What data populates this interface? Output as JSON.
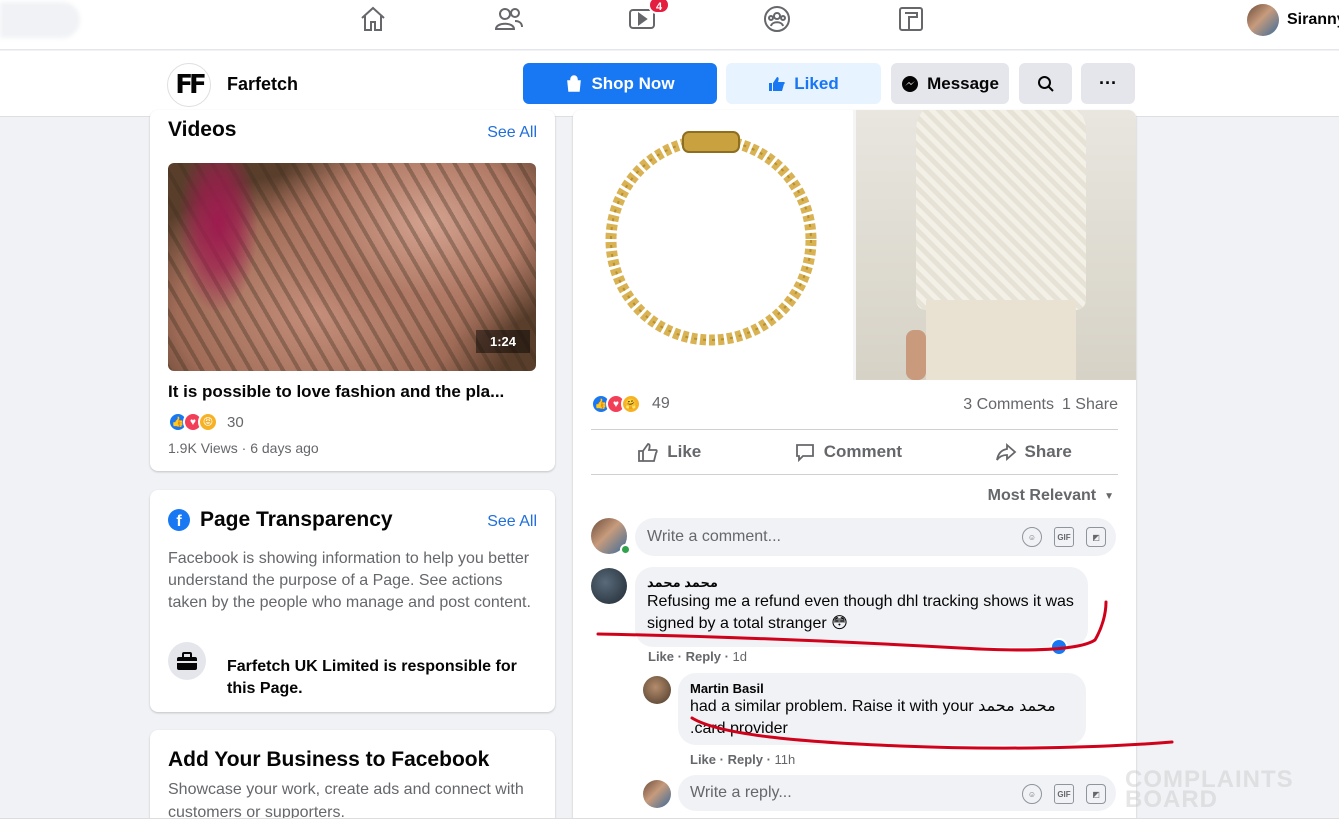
{
  "topnav": {
    "notification_count": "4",
    "user_name": "Siranny",
    "icons": [
      "home-icon",
      "friends-icon",
      "watch-icon",
      "groups-icon",
      "gaming-icon"
    ]
  },
  "pagebar": {
    "page_name": "Farfetch",
    "logo_text": "FF",
    "shop_now": "Shop Now",
    "liked": "Liked",
    "message": "Message",
    "more": "···"
  },
  "videos": {
    "title": "Videos",
    "see_all": "See All",
    "duration": "1:24",
    "video_title": "It is possible to love fashion and the pla...",
    "reactions": "30",
    "meta": "1.9K Views · 6 days ago"
  },
  "transparency": {
    "title": "Page Transparency",
    "see_all": "See All",
    "description": "Facebook is showing information to help you better understand the purpose of a Page. See actions taken by the people who manage and post content.",
    "responsible": "Farfetch UK Limited is responsible for this Page."
  },
  "add_business": {
    "title": "Add Your Business to Facebook",
    "description": "Showcase your work, create ads and connect with customers or supporters."
  },
  "post": {
    "reactions_count": "49",
    "comments": "3 Comments",
    "shares": "1 Share",
    "like": "Like",
    "comment": "Comment",
    "share": "Share",
    "sort": "Most Relevant",
    "comment_placeholder": "Write a comment...",
    "comment1": {
      "author": "محمد محمد",
      "text": "Refusing me a refund even though dhl tracking shows it was signed by a total stranger 😳",
      "like": "Like",
      "reply": "Reply",
      "time": "1d"
    },
    "reply1": {
      "author": "Martin Basil",
      "text": "had a similar problem. Raise it with your محمد محمد .card provider",
      "like": "Like",
      "reply": "Reply",
      "time": "11h"
    },
    "reply_placeholder": "Write a reply..."
  },
  "watermark": "COMPLAINTS BOARD",
  "colors": {
    "brand": "#1877f2",
    "liked_bg": "#e7f3ff",
    "annotation": "#d0021b"
  }
}
